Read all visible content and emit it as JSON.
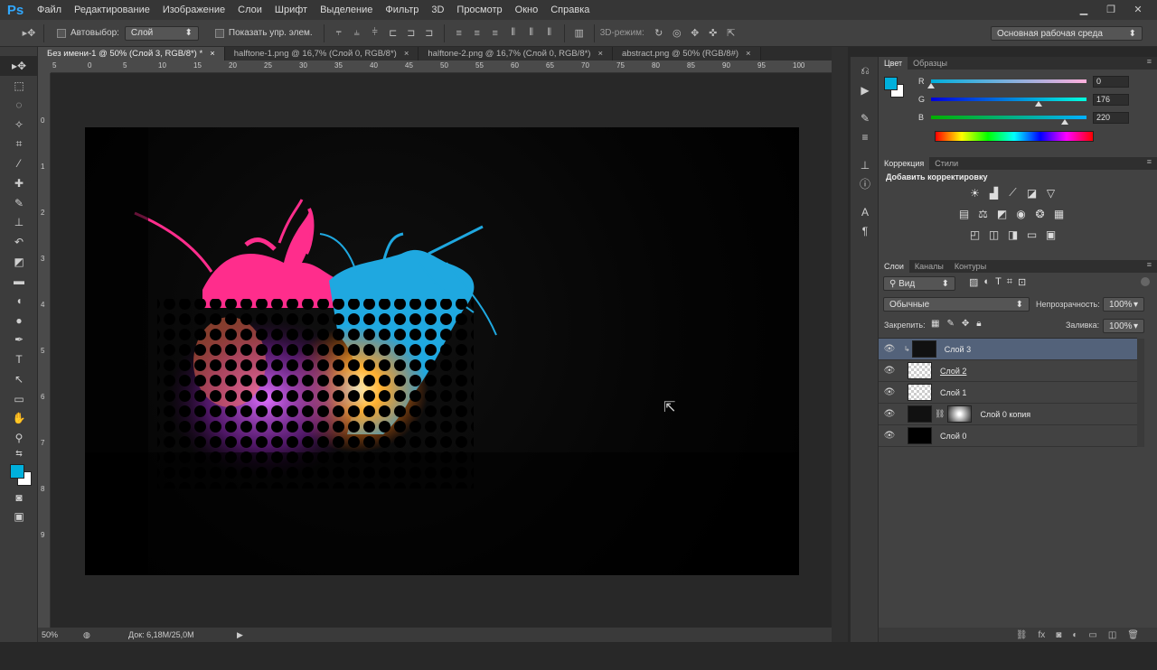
{
  "app": {
    "logo": "Ps"
  },
  "menu": [
    "Файл",
    "Редактирование",
    "Изображение",
    "Слои",
    "Шрифт",
    "Выделение",
    "Фильтр",
    "3D",
    "Просмотр",
    "Окно",
    "Справка"
  ],
  "options": {
    "autoselect_label": "Автовыбор:",
    "autoselect_value": "Слой",
    "show_transform_label": "Показать упр. элем.",
    "mode3d_label": "3D-режим:",
    "workspace": "Основная рабочая среда"
  },
  "tabs": [
    {
      "label": "Без имени-1 @ 50% (Слой 3, RGB/8*) *",
      "close": "×"
    },
    {
      "label": "halftone-1.png @ 16,7% (Слой 0, RGB/8*)",
      "close": "×"
    },
    {
      "label": "halftone-2.png @ 16,7% (Слой 0, RGB/8*)",
      "close": "×"
    },
    {
      "label": "abstract.png @ 50% (RGB/8#)",
      "close": "×"
    }
  ],
  "ruler_h": [
    "5",
    "0",
    "5",
    "10",
    "15",
    "20",
    "25",
    "30",
    "35",
    "40",
    "45",
    "50",
    "55",
    "60",
    "65",
    "70",
    "75",
    "80",
    "85",
    "90",
    "95",
    "100"
  ],
  "ruler_v": [
    "0",
    "1",
    "2",
    "3",
    "4",
    "5",
    "6",
    "7",
    "8",
    "9"
  ],
  "status": {
    "zoom": "50%",
    "doc": "Док: 6,18M/25,0M"
  },
  "color_panel": {
    "tabs": [
      "Цвет",
      "Образцы"
    ],
    "r_label": "R",
    "g_label": "G",
    "b_label": "B",
    "r": 0,
    "g": 176,
    "b": 220,
    "r_text": "0",
    "g_text": "176",
    "b_text": "220",
    "foreground": "#00b0dc"
  },
  "adjust_panel": {
    "tabs": [
      "Коррекция",
      "Стили"
    ],
    "title": "Добавить корректировку"
  },
  "layers_panel": {
    "tabs": [
      "Слои",
      "Каналы",
      "Контуры"
    ],
    "filter": "Вид",
    "blend": "Обычные",
    "opacity_label": "Непрозрачность:",
    "opacity": "100%",
    "lock_label": "Закрепить:",
    "fill_label": "Заливка:",
    "fill": "100%",
    "layers": [
      {
        "name": "Слой 3",
        "selected": true
      },
      {
        "name": "Слой 2",
        "selected": false
      },
      {
        "name": "Слой 1",
        "selected": false
      },
      {
        "name": "Слой 0 копия",
        "selected": false
      },
      {
        "name": "Слой 0",
        "selected": false
      }
    ]
  },
  "colors": {
    "accent": "#31a8ff",
    "selected_row": "#53627a",
    "pink": "#ff2d8c",
    "cyan": "#1fa8e0"
  }
}
